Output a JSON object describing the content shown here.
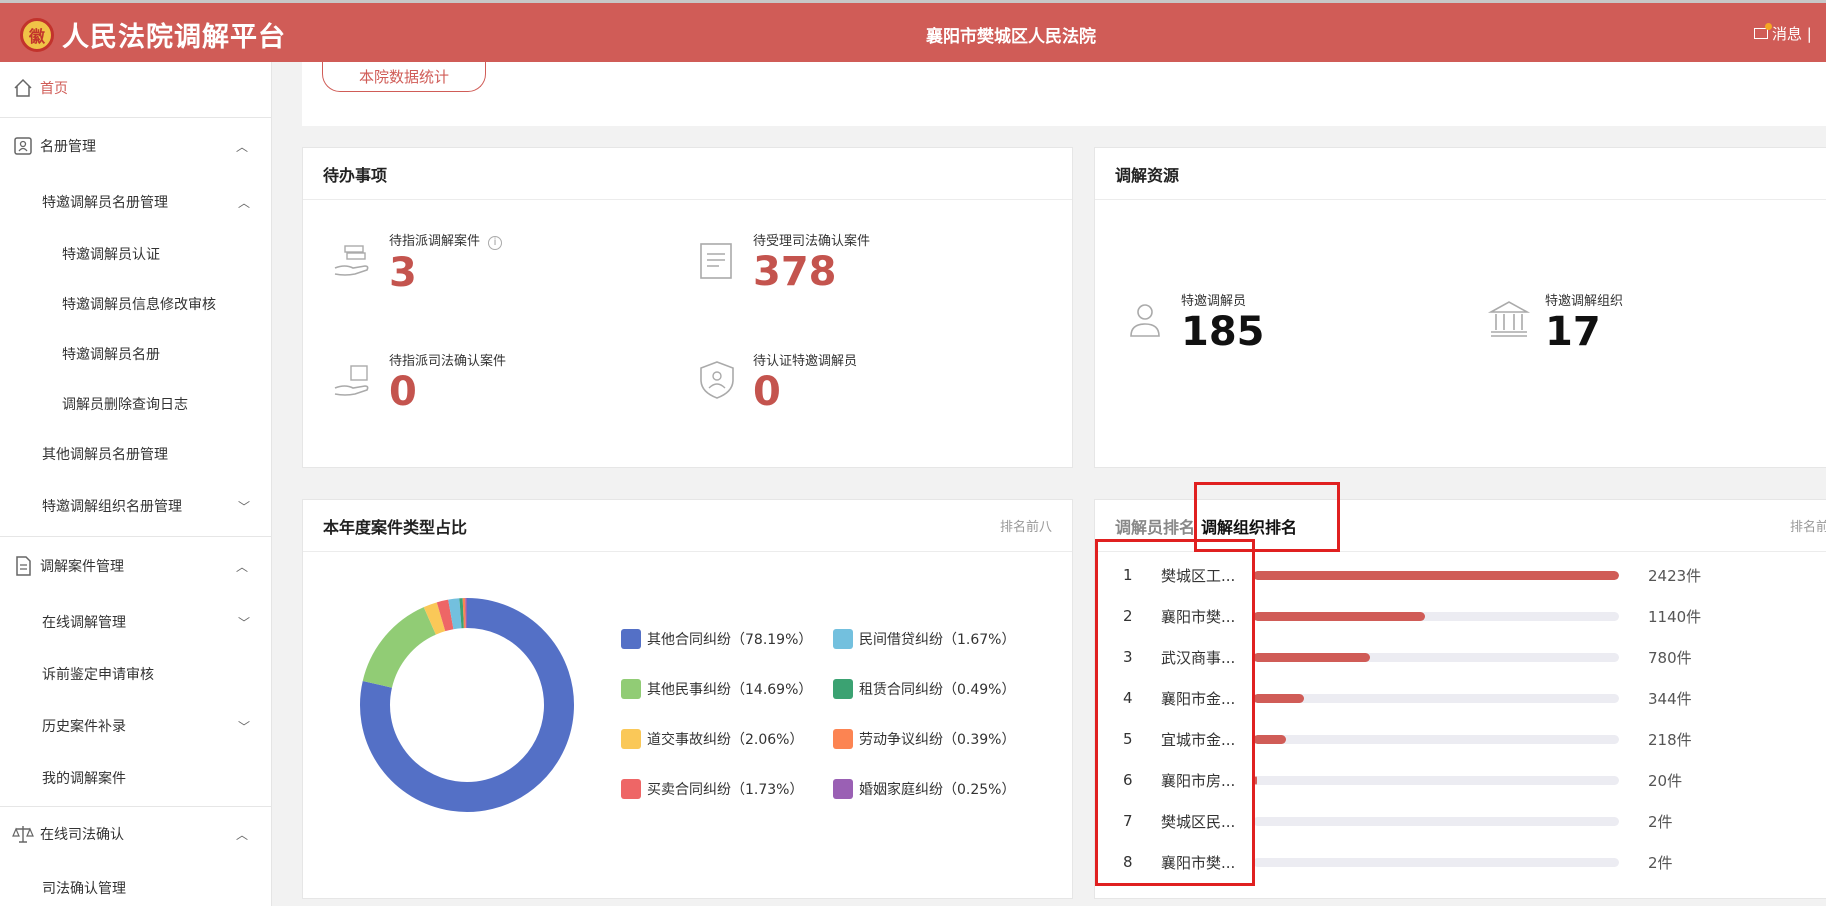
{
  "header": {
    "app_title": "人民法院调解平台",
    "court_name": "襄阳市樊城区人民法院",
    "messages_label": "消息 | ",
    "emblem_glyph": "徽"
  },
  "sidebar": {
    "home": "首页",
    "roster": "名册管理",
    "special_roster": "特邀调解员名册管理",
    "cert": "特邀调解员认证",
    "info_review": "特邀调解员信息修改审核",
    "special_list": "特邀调解员名册",
    "delete_log": "调解员删除查询日志",
    "other_roster": "其他调解员名册管理",
    "org_roster": "特邀调解组织名册管理",
    "case_mgmt": "调解案件管理",
    "online_mgmt": "在线调解管理",
    "appraisal": "诉前鉴定申请审核",
    "history": "历史案件补录",
    "my_cases": "我的调解案件",
    "judicial": "在线司法确认",
    "judicial_mgmt": "司法确认管理"
  },
  "top": {
    "stats_button": "本院数据统计"
  },
  "todo": {
    "title": "待办事项",
    "items": [
      {
        "label": "待指派调解案件",
        "value": "3",
        "icon": "hand-cases-icon"
      },
      {
        "label": "待受理司法确认案件",
        "value": "378",
        "icon": "document-icon"
      },
      {
        "label": "待指派司法确认案件",
        "value": "0",
        "icon": "hand-judicial-icon"
      },
      {
        "label": "待认证特邀调解员",
        "value": "0",
        "icon": "shield-user-icon"
      }
    ],
    "info_glyph": "i"
  },
  "resources": {
    "title": "调解资源",
    "items": [
      {
        "label": "特邀调解员",
        "value": "185",
        "icon": "person-icon"
      },
      {
        "label": "特邀调解组织",
        "value": "17",
        "icon": "institution-icon"
      }
    ]
  },
  "case_types": {
    "title": "本年度案件类型占比",
    "note": "排名前八",
    "legend": [
      "其他合同纠纷（78.19%）",
      "民间借贷纠纷（1.67%）",
      "其他民事纠纷（14.69%）",
      "租赁合同纠纷（0.49%）",
      "道交事故纠纷（2.06%）",
      "劳动争议纠纷（0.39%）",
      "买卖合同纠纷（1.73%）",
      "婚姻家庭纠纷（0.25%）"
    ]
  },
  "ranking": {
    "tab_mediator": "调解员排名",
    "tab_org": "调解组织排名",
    "note": "排名前",
    "rows": [
      {
        "no": "1",
        "name": "樊城区工...",
        "count": "2423件"
      },
      {
        "no": "2",
        "name": "襄阳市樊...",
        "count": "1140件"
      },
      {
        "no": "3",
        "name": "武汉商事...",
        "count": "780件"
      },
      {
        "no": "4",
        "name": "襄阳市金...",
        "count": "344件"
      },
      {
        "no": "5",
        "name": "宜城市金...",
        "count": "218件"
      },
      {
        "no": "6",
        "name": "襄阳市房...",
        "count": "20件"
      },
      {
        "no": "7",
        "name": "樊城区民...",
        "count": "2件"
      },
      {
        "no": "8",
        "name": "襄阳市樊...",
        "count": "2件"
      }
    ],
    "fill_fractions": [
      1.0,
      0.47,
      0.32,
      0.14,
      0.09,
      0.01,
      0.0,
      0.0
    ]
  },
  "chart_data": {
    "type": "pie",
    "title": "本年度案件类型占比",
    "series": [
      {
        "name": "其他合同纠纷",
        "value": 78.19,
        "color": "#5470c6"
      },
      {
        "name": "其他民事纠纷",
        "value": 14.69,
        "color": "#91cc75"
      },
      {
        "name": "道交事故纠纷",
        "value": 2.06,
        "color": "#fac858"
      },
      {
        "name": "买卖合同纠纷",
        "value": 1.73,
        "color": "#ee6666"
      },
      {
        "name": "民间借贷纠纷",
        "value": 1.67,
        "color": "#73c0de"
      },
      {
        "name": "租赁合同纠纷",
        "value": 0.49,
        "color": "#3ba272"
      },
      {
        "name": "劳动争议纠纷",
        "value": 0.39,
        "color": "#fc8452"
      },
      {
        "name": "婚姻家庭纠纷",
        "value": 0.25,
        "color": "#9a60b4"
      }
    ],
    "legend_order": [
      0,
      4,
      1,
      5,
      2,
      6,
      3,
      7
    ]
  },
  "colors": {
    "brand": "#d05c57",
    "accent_value": "#c4544e",
    "highlight": "#e02020"
  }
}
